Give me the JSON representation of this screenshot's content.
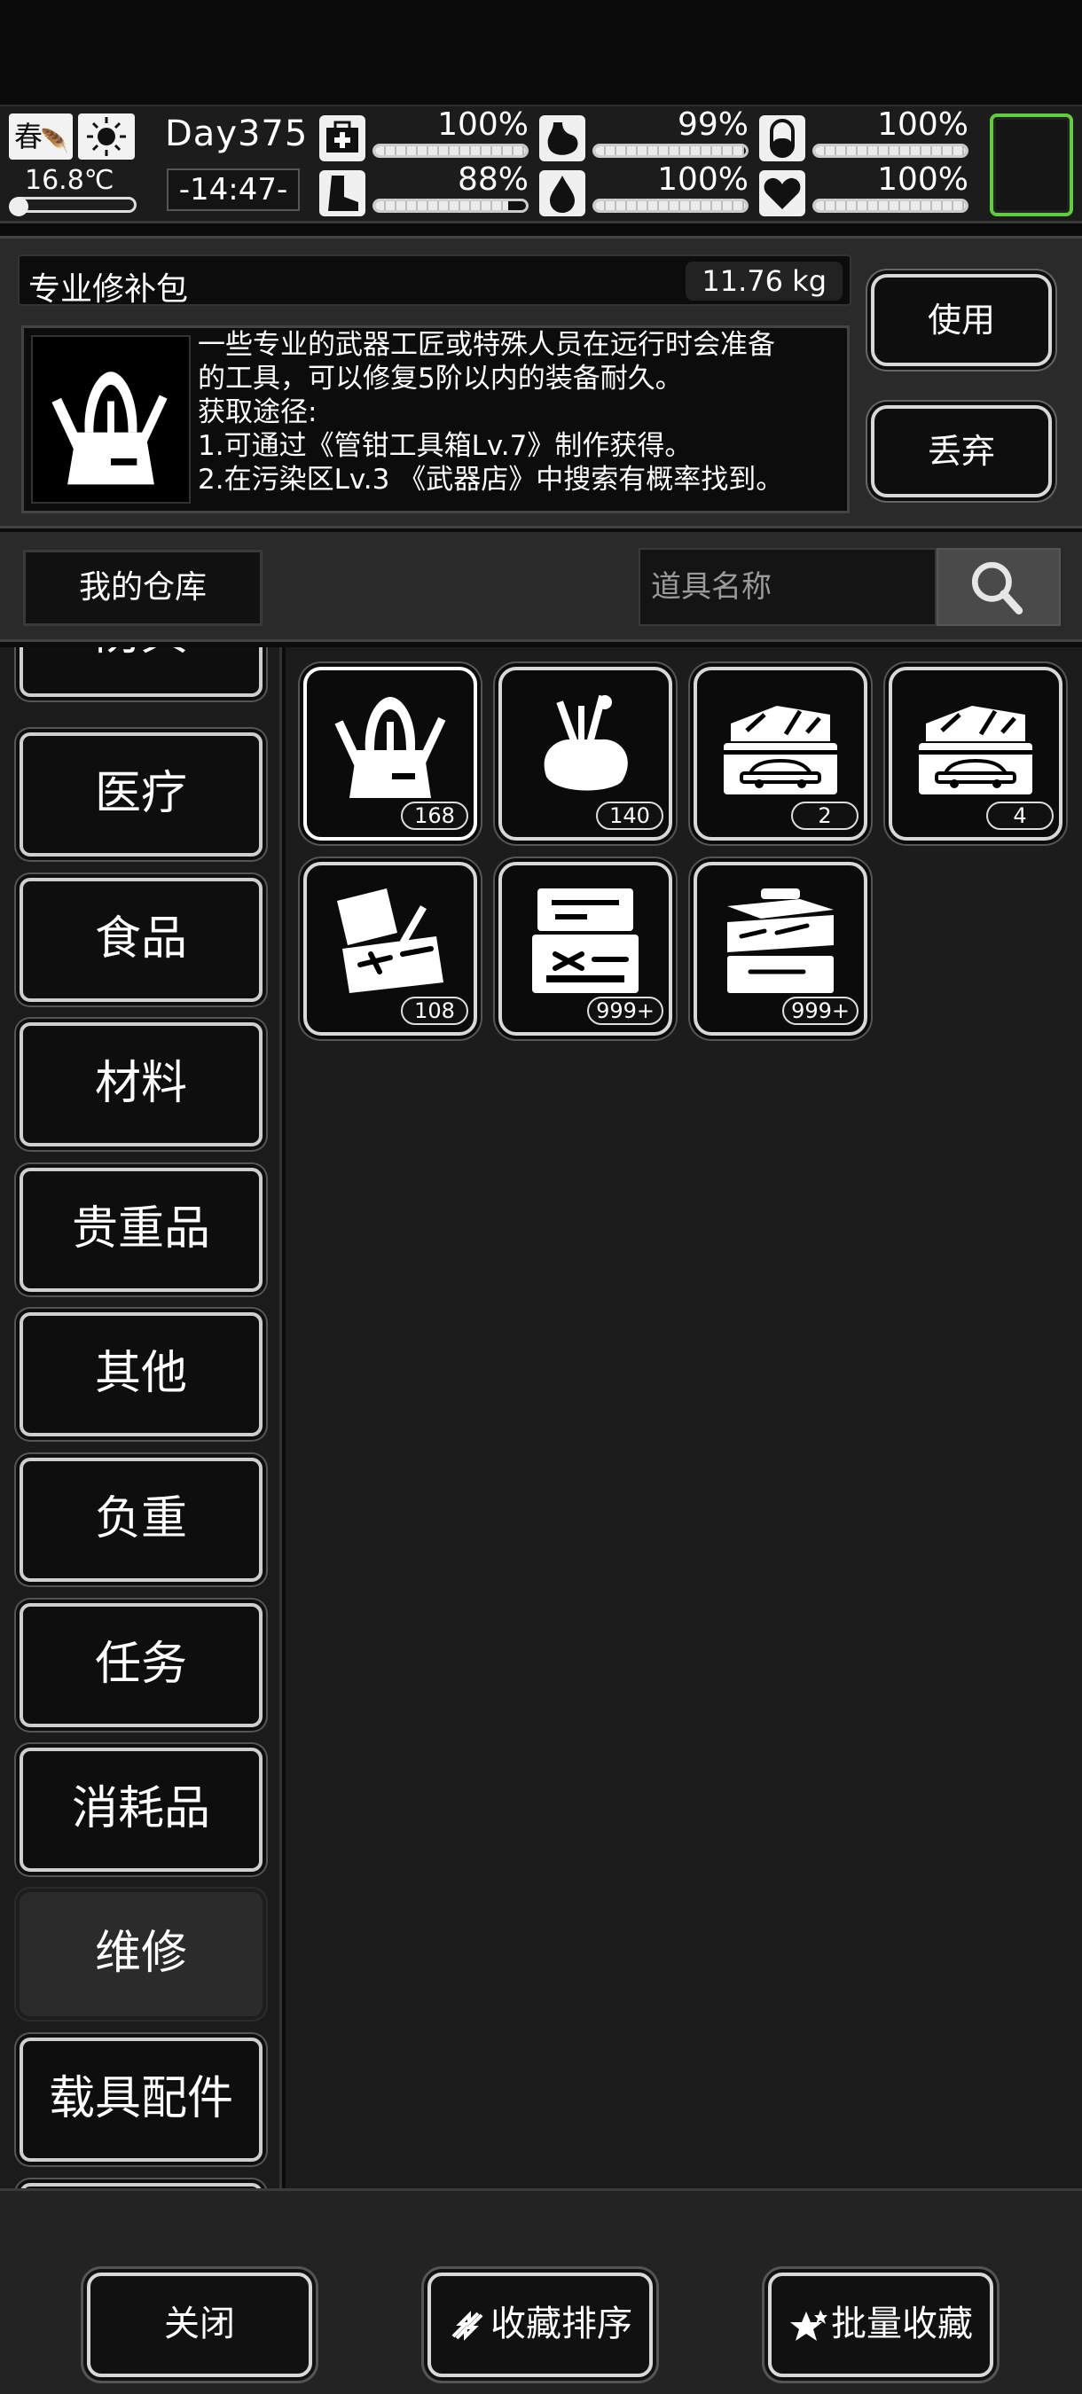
{
  "status": {
    "season": "春",
    "temperature": "16.8℃",
    "day": "Day375",
    "time": "-14:47-",
    "stats": [
      {
        "name": "health",
        "icon": "first-aid-icon",
        "value": "100%",
        "level": 1.0
      },
      {
        "name": "hunger",
        "icon": "stomach-icon",
        "value": "99%",
        "level": 0.99
      },
      {
        "name": "stamina",
        "icon": "pill-icon",
        "value": "100%",
        "level": 1.0
      },
      {
        "name": "energy",
        "icon": "boot-icon",
        "value": "88%",
        "level": 0.88
      },
      {
        "name": "thirst",
        "icon": "water-drop-icon",
        "value": "100%",
        "level": 1.0
      },
      {
        "name": "mood",
        "icon": "heart-icon",
        "value": "100%",
        "level": 1.0
      }
    ],
    "portrait_border_color": "#5ecf3a"
  },
  "item": {
    "name": "专业修补包",
    "weight": "11.76 kg",
    "description": [
      "一些专业的武器工匠或特殊人员在远行时会准备",
      "的工具，可以修复5阶以内的装备耐久。",
      "获取途径:",
      "1.可通过《管钳工具箱Lv.7》制作获得。",
      "2.在污染区Lv.3 《武器店》中搜索有概率找到。"
    ],
    "use_label": "使用",
    "drop_label": "丢弃"
  },
  "warehouse": {
    "label": "我的仓库",
    "search_placeholder": "道具名称"
  },
  "categories": [
    {
      "label": "防具",
      "active": false
    },
    {
      "label": "医疗",
      "active": false
    },
    {
      "label": "食品",
      "active": false
    },
    {
      "label": "材料",
      "active": false
    },
    {
      "label": "贵重品",
      "active": false
    },
    {
      "label": "其他",
      "active": false
    },
    {
      "label": "负重",
      "active": false
    },
    {
      "label": "任务",
      "active": false
    },
    {
      "label": "消耗品",
      "active": false
    },
    {
      "label": "维修",
      "active": true
    },
    {
      "label": "载具配件",
      "active": false
    }
  ],
  "items": [
    {
      "icon": "repair-bag-icon",
      "count": "168",
      "selected": true
    },
    {
      "icon": "tool-pouch-icon",
      "count": "140",
      "selected": false
    },
    {
      "icon": "car-toolbox-icon",
      "count": "2",
      "selected": false
    },
    {
      "icon": "car-toolbox-icon",
      "count": "4",
      "selected": false
    },
    {
      "icon": "open-toolbox-icon",
      "count": "108",
      "selected": false
    },
    {
      "icon": "tool-case-icon",
      "count": "999+",
      "selected": false
    },
    {
      "icon": "tiered-toolbox-icon",
      "count": "999+",
      "selected": false
    }
  ],
  "footer": {
    "close_label": "关闭",
    "sort_label": "收藏排序",
    "batch_label": "批量收藏"
  }
}
